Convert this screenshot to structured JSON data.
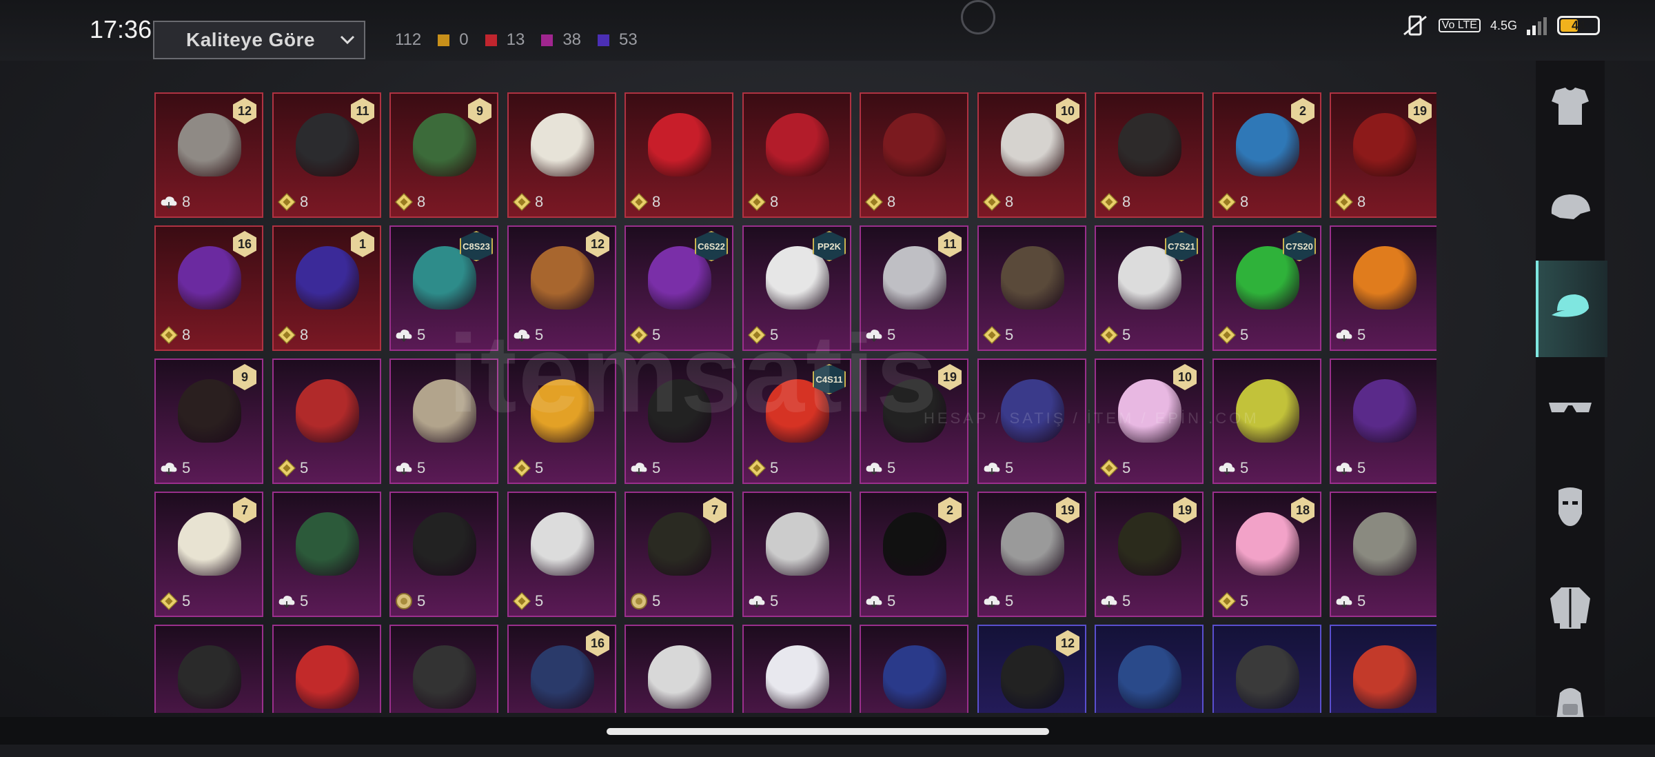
{
  "status_bar": {
    "time": "17:36",
    "net_label": "4.5G",
    "volte_label": "Vo LTE",
    "battery": "44"
  },
  "sort": {
    "label": "Kaliteye Göre"
  },
  "counts": {
    "total": "112",
    "groups": [
      {
        "color": "#c8901a",
        "value": "0"
      },
      {
        "color": "#c0252e",
        "value": "13"
      },
      {
        "color": "#a0268f",
        "value": "38"
      },
      {
        "color": "#4b2fb5",
        "value": "53"
      }
    ]
  },
  "watermark": {
    "text": "itemsatis",
    "sub": "HESAP / SATIŞ / İTEM / EPİN .COM"
  },
  "rows": [
    [
      {
        "rarity": "red",
        "badge": "12",
        "cost": "8",
        "icon": "cloud"
      },
      {
        "rarity": "red",
        "badge": "11",
        "cost": "8",
        "icon": "diamond"
      },
      {
        "rarity": "red",
        "badge": "9",
        "cost": "8",
        "icon": "diamond"
      },
      {
        "rarity": "red",
        "badge": "",
        "cost": "8",
        "icon": "diamond"
      },
      {
        "rarity": "red",
        "badge": "",
        "cost": "8",
        "icon": "diamond"
      },
      {
        "rarity": "red",
        "badge": "",
        "cost": "8",
        "icon": "diamond"
      },
      {
        "rarity": "red",
        "badge": "",
        "cost": "8",
        "icon": "diamond"
      },
      {
        "rarity": "red",
        "badge": "10",
        "cost": "8",
        "icon": "diamond"
      },
      {
        "rarity": "red",
        "badge": "",
        "cost": "8",
        "icon": "diamond"
      },
      {
        "rarity": "red",
        "badge": "2",
        "cost": "8",
        "icon": "diamond"
      },
      {
        "rarity": "red",
        "badge": "19",
        "cost": "8",
        "icon": "diamond"
      }
    ],
    [
      {
        "rarity": "red",
        "badge": "16",
        "cost": "8",
        "icon": "diamond"
      },
      {
        "rarity": "red",
        "badge": "1",
        "cost": "8",
        "icon": "diamond"
      },
      {
        "rarity": "purple",
        "tag": "C8S23",
        "cost": "5",
        "icon": "cloud"
      },
      {
        "rarity": "purple",
        "badge": "12",
        "cost": "5",
        "icon": "cloud"
      },
      {
        "rarity": "purple",
        "tag": "C6S22",
        "cost": "5",
        "icon": "diamond"
      },
      {
        "rarity": "purple",
        "tag": "PP2K",
        "cost": "5",
        "icon": "diamond"
      },
      {
        "rarity": "purple",
        "badge": "11",
        "cost": "5",
        "icon": "cloud"
      },
      {
        "rarity": "purple",
        "badge": "",
        "cost": "5",
        "icon": "diamond"
      },
      {
        "rarity": "purple",
        "tag": "C7S21",
        "cost": "5",
        "icon": "diamond"
      },
      {
        "rarity": "purple",
        "tag": "C7S20",
        "cost": "5",
        "icon": "diamond"
      },
      {
        "rarity": "purple",
        "badge": "",
        "cost": "5",
        "icon": "cloud"
      }
    ],
    [
      {
        "rarity": "purple",
        "badge": "9",
        "cost": "5",
        "icon": "cloud"
      },
      {
        "rarity": "purple",
        "badge": "",
        "cost": "5",
        "icon": "diamond"
      },
      {
        "rarity": "purple",
        "badge": "",
        "cost": "5",
        "icon": "cloud"
      },
      {
        "rarity": "purple",
        "badge": "",
        "cost": "5",
        "icon": "diamond"
      },
      {
        "rarity": "purple",
        "badge": "",
        "cost": "5",
        "icon": "cloud"
      },
      {
        "rarity": "purple",
        "tag": "C4S11",
        "cost": "5",
        "icon": "diamond"
      },
      {
        "rarity": "purple",
        "badge": "19",
        "cost": "5",
        "icon": "cloud"
      },
      {
        "rarity": "purple",
        "badge": "",
        "cost": "5",
        "icon": "cloud"
      },
      {
        "rarity": "purple",
        "badge": "10",
        "cost": "5",
        "icon": "diamond"
      },
      {
        "rarity": "purple",
        "badge": "",
        "cost": "5",
        "icon": "cloud"
      },
      {
        "rarity": "purple",
        "badge": "",
        "cost": "5",
        "icon": "cloud"
      }
    ],
    [
      {
        "rarity": "purple",
        "badge": "7",
        "cost": "5",
        "icon": "diamond"
      },
      {
        "rarity": "purple",
        "badge": "",
        "cost": "5",
        "icon": "cloud"
      },
      {
        "rarity": "purple",
        "badge": "",
        "cost": "5",
        "icon": "coin"
      },
      {
        "rarity": "purple",
        "badge": "",
        "cost": "5",
        "icon": "diamond"
      },
      {
        "rarity": "purple",
        "badge": "7",
        "cost": "5",
        "icon": "coin"
      },
      {
        "rarity": "purple",
        "badge": "",
        "cost": "5",
        "icon": "cloud"
      },
      {
        "rarity": "purple",
        "badge": "2",
        "cost": "5",
        "icon": "cloud"
      },
      {
        "rarity": "purple",
        "badge": "19",
        "cost": "5",
        "icon": "cloud"
      },
      {
        "rarity": "purple",
        "badge": "19",
        "cost": "5",
        "icon": "cloud"
      },
      {
        "rarity": "purple",
        "badge": "18",
        "cost": "5",
        "icon": "diamond"
      },
      {
        "rarity": "purple",
        "badge": "",
        "cost": "5",
        "icon": "cloud"
      }
    ],
    [
      {
        "rarity": "purple",
        "badge": "",
        "cost": "",
        "icon": ""
      },
      {
        "rarity": "purple",
        "badge": "",
        "cost": "",
        "icon": ""
      },
      {
        "rarity": "purple",
        "badge": "",
        "cost": "",
        "icon": ""
      },
      {
        "rarity": "purple",
        "badge": "16",
        "cost": "",
        "icon": ""
      },
      {
        "rarity": "purple",
        "badge": "",
        "cost": "",
        "icon": ""
      },
      {
        "rarity": "purple",
        "badge": "",
        "cost": "",
        "icon": ""
      },
      {
        "rarity": "purple",
        "badge": "",
        "cost": "",
        "icon": ""
      },
      {
        "rarity": "blue",
        "badge": "12",
        "cost": "",
        "icon": ""
      },
      {
        "rarity": "blue",
        "badge": "",
        "cost": "",
        "icon": ""
      },
      {
        "rarity": "blue",
        "badge": "",
        "cost": "",
        "icon": ""
      },
      {
        "rarity": "blue",
        "badge": "",
        "cost": "",
        "icon": ""
      }
    ]
  ],
  "item_colors": [
    [
      "#8f8a85",
      "#2b2b2e",
      "#3c6b3a",
      "#e7e3d8",
      "#c81e2a",
      "#b31c2a",
      "#7b1a1f",
      "#d6d3cf",
      "#2d2a2a",
      "#2f78b7",
      "#8d1a1a"
    ],
    [
      "#6b2aa0",
      "#3b2a99",
      "#2e8c8a",
      "#a8662e",
      "#7a2fa8",
      "#e6e6e6",
      "#bfbfc4",
      "#5a4a3a",
      "#dcdcdc",
      "#2fb23a",
      "#e07c1d"
    ],
    [
      "#2a1f1f",
      "#b12a2a",
      "#b2a48c",
      "#e3a126",
      "#222",
      "#d63324",
      "#222",
      "#3a3a8a",
      "#e8b8e2",
      "#c2c23a",
      "#5a2a8a"
    ],
    [
      "#e8e3d2",
      "#2c5a3a",
      "#222",
      "#dcdcdc",
      "#2a2a22",
      "#ccc",
      "#111",
      "#9a9a9a",
      "#2b2b1c",
      "#f2a2c8",
      "#8a8a80"
    ],
    [
      "#2a2a2a",
      "#c22a2a",
      "#333",
      "#2a3a6a",
      "#d8d8d8",
      "#e8e8ee",
      "#2a3a8a",
      "#222",
      "#2a4a8a",
      "#3a3a3a",
      "#c33a2a"
    ]
  ],
  "rail": [
    {
      "name": "outfit-icon"
    },
    {
      "name": "helmet-icon"
    },
    {
      "name": "cap-icon",
      "active": true
    },
    {
      "name": "glasses-icon"
    },
    {
      "name": "mask-icon"
    },
    {
      "name": "jacket-icon"
    },
    {
      "name": "backpack-icon"
    }
  ]
}
